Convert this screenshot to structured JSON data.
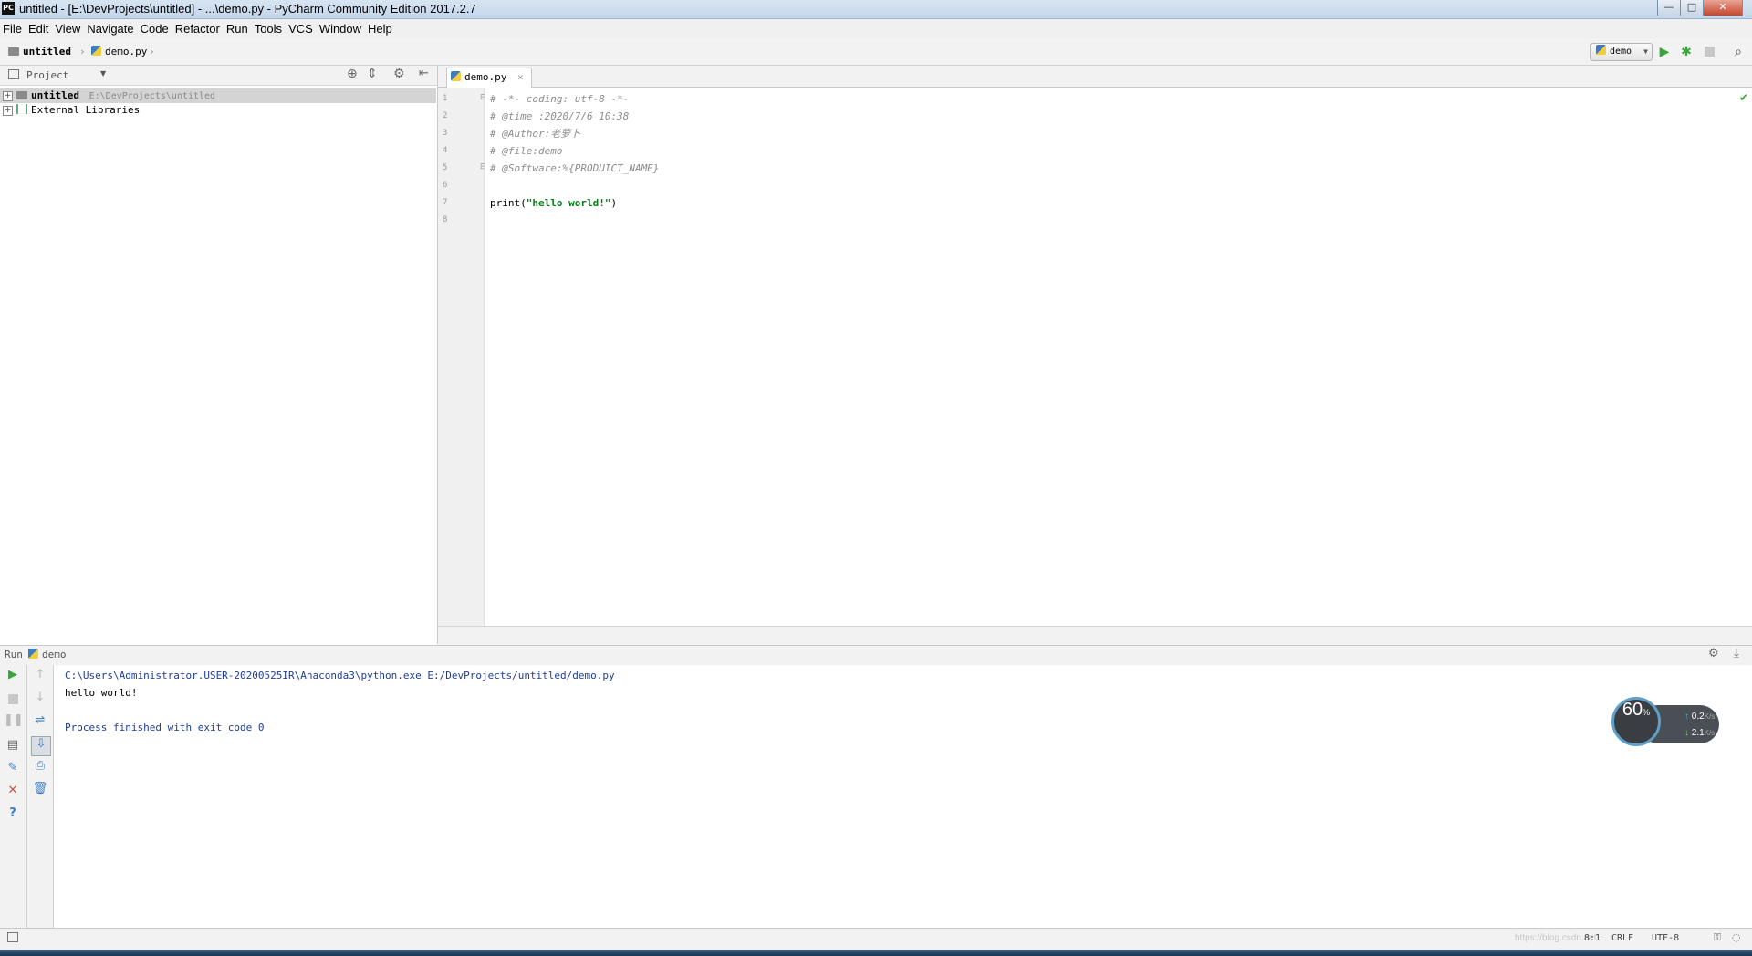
{
  "window": {
    "title": "untitled - [E:\\DevProjects\\untitled] - ...\\demo.py - PyCharm Community Edition 2017.2.7",
    "logo_text": "PC",
    "minimize": "—",
    "maximize": "□",
    "close": "✕"
  },
  "menu": [
    "File",
    "Edit",
    "View",
    "Navigate",
    "Code",
    "Refactor",
    "Run",
    "Tools",
    "VCS",
    "Window",
    "Help"
  ],
  "nav": {
    "crumb_project": "untitled",
    "crumb_file": "demo.py",
    "run_config": "demo"
  },
  "project_panel": {
    "title": "Project",
    "tree": [
      {
        "label": "untitled",
        "path": "E:\\DevProjects\\untitled"
      },
      {
        "label": "External Libraries",
        "path": ""
      }
    ]
  },
  "editor": {
    "tab_label": "demo.py",
    "line_numbers": [
      "1",
      "2",
      "3",
      "4",
      "5",
      "6",
      "7",
      "8"
    ],
    "lines": [
      "# -*- coding: utf-8 -*-",
      "# @time :2020/7/6 10:38",
      "# @Author:老萝卜",
      "# @file:demo",
      "# @Software:%{PRODUICT_NAME}",
      "",
      "print(\"hello world!\")",
      ""
    ],
    "print_fn": "print(",
    "print_str": "\"hello world!\"",
    "print_close": ")"
  },
  "run_panel": {
    "label": "Run",
    "config": "demo",
    "console": [
      "C:\\Users\\Administrator.USER-20200525IR\\Anaconda3\\python.exe E:/DevProjects/untitled/demo.py",
      "hello world!",
      "",
      "Process finished with exit code 0"
    ]
  },
  "status": {
    "position": "8:1",
    "line_sep": "CRLF",
    "encoding": "UTF-8",
    "watermark": "https://blog.csdn.net"
  },
  "net_widget": {
    "cpu": "60",
    "cpu_unit": "%",
    "up": "0.2",
    "down": "2.1",
    "unit": "K/s"
  },
  "colors": {
    "run_green": "#3aa53a",
    "stop_red": "#c94f4f",
    "accent_blue": "#3d7cc0"
  }
}
